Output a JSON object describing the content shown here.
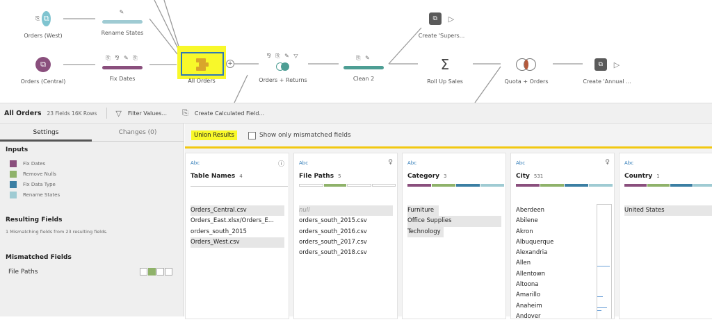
{
  "flow": {
    "nodes": {
      "orders_west": "Orders (West)",
      "rename_states": "Rename States",
      "create_supers": "Create 'Supers...",
      "orders_central": "Orders (Central)",
      "fix_dates": "Fix Dates",
      "all_orders": "All Orders",
      "orders_returns": "Orders + Returns",
      "clean2": "Clean 2",
      "roll_up_sales": "Roll Up Sales",
      "quota_orders": "Quota + Orders",
      "create_annual": "Create 'Annual ..."
    },
    "colors": {
      "clean_purple": "#8a4f7d",
      "clean_teal": "#4d9e94",
      "rename_blue": "#9fcbd3",
      "input_blue": "#7fc4d0",
      "selection": "#f8f82a"
    }
  },
  "toolbar": {
    "step_name": "All Orders",
    "meta": "23 Fields  16K Rows",
    "filter_label": "Filter Values...",
    "calc_label": "Create Calculated Field..."
  },
  "settings": {
    "tab_settings": "Settings",
    "tab_changes": "Changes (0)",
    "inputs_title": "Inputs",
    "inputs": [
      {
        "label": "Fix Dates",
        "color": "#8a4f7d"
      },
      {
        "label": "Remove Nulls",
        "color": "#8fb26a"
      },
      {
        "label": "Fix Data Type",
        "color": "#3b7fa3"
      },
      {
        "label": "Rename States",
        "color": "#9fcbd3"
      }
    ],
    "resulting_title": "Resulting Fields",
    "resulting_text": "1 Mismatching fields from 23 resulting fields.",
    "mismatched_title": "Mismatched Fields",
    "mismatched_field": "File Paths"
  },
  "results": {
    "union_label": "Union Results",
    "show_mismatched": "Show only mismatched fields",
    "cards": [
      {
        "type": "Abc",
        "name": "Table Names",
        "count": "4",
        "icon": "info-icon",
        "values": [
          "Orders_Central.csv",
          "Orders_East.xlsx/Orders_E...",
          "orders_south_2015",
          "Orders_West.csv"
        ]
      },
      {
        "type": "Abc",
        "name": "File Paths",
        "count": "5",
        "icon": "lightbulb-icon",
        "values": [
          "null",
          "orders_south_2015.csv",
          "orders_south_2016.csv",
          "orders_south_2017.csv",
          "orders_south_2018.csv"
        ]
      },
      {
        "type": "Abc",
        "name": "Category",
        "count": "3",
        "icon": "",
        "values": [
          "Furniture",
          "Office Supplies",
          "Technology"
        ]
      },
      {
        "type": "Abc",
        "name": "City",
        "count": "531",
        "icon": "lightbulb-icon",
        "values": [
          "Aberdeen",
          "Abilene",
          "Akron",
          "Albuquerque",
          "Alexandria",
          "Allen",
          "Allentown",
          "Altoona",
          "Amarillo",
          "Anaheim",
          "Andover"
        ]
      },
      {
        "type": "Abc",
        "name": "Country",
        "count": "1",
        "icon": "",
        "values": [
          "United States"
        ]
      }
    ]
  }
}
